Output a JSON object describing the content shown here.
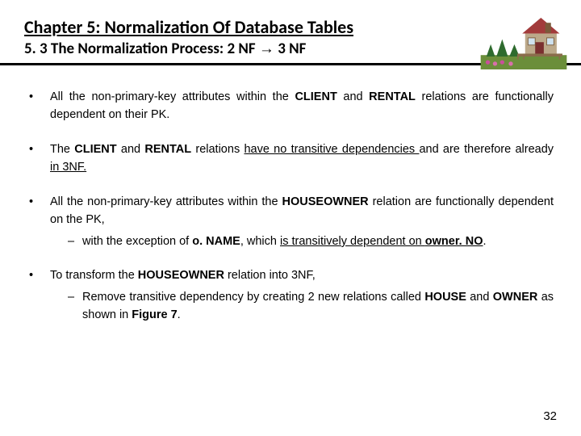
{
  "header": {
    "chapter": "Chapter 5: Normalization Of Database Tables",
    "section_pre": "5. 3 The Normalization Process: 2 NF ",
    "section_arrow": "→",
    "section_post": " 3 NF"
  },
  "bullets": {
    "b1": {
      "t1": "All the non-primary-key attributes within the ",
      "client": "CLIENT",
      "and": " and ",
      "rental": "RENTAL",
      "t2": " relations are functionally dependent on their PK."
    },
    "b2": {
      "t1": "The ",
      "client": "CLIENT",
      "and": " and ",
      "rental": "RENTAL",
      "t2": " relations ",
      "u1": "have no transitive dependencies ",
      "t3": "and are therefore already ",
      "u2": "in 3NF.",
      "t4": ""
    },
    "b3": {
      "t1": "All the non-primary-key attributes within the ",
      "houseowner": "HOUSEOWNER",
      "t2": " relation are functionally dependent on the PK,",
      "sub": {
        "t1": "with the exception of ",
        "oname": "o. NAME",
        "t2": ", which ",
        "u1": "is transitively dependent on ",
        "ownerNO": "owner. NO",
        "t3": "."
      }
    },
    "b4": {
      "t1": "To transform the ",
      "houseowner": "HOUSEOWNER",
      "t2": " relation into 3NF,",
      "sub": {
        "t1": "Remove transitive dependency by creating 2 new relations called ",
        "house": "HOUSE",
        "and": " and ",
        "owner": "OWNER",
        "t2": " as shown in ",
        "fig": "Figure 7",
        "t3": "."
      }
    }
  },
  "page_number": "32"
}
